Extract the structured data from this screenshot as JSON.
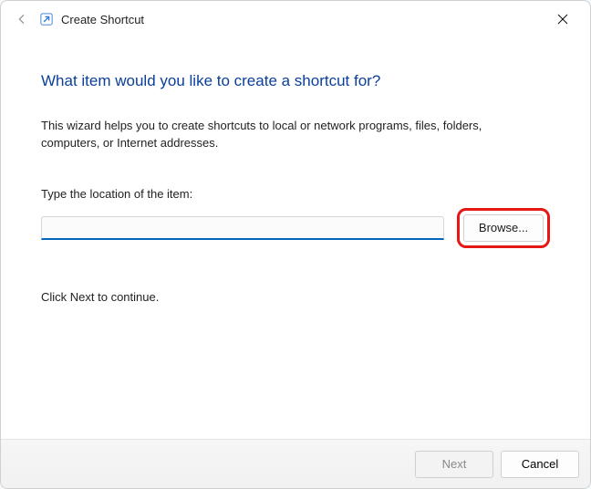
{
  "titlebar": {
    "title": "Create Shortcut"
  },
  "content": {
    "heading": "What item would you like to create a shortcut for?",
    "description": "This wizard helps you to create shortcuts to local or network programs, files, folders, computers, or Internet addresses.",
    "input_label": "Type the location of the item:",
    "input_value": "",
    "browse_label": "Browse...",
    "continue_hint": "Click Next to continue."
  },
  "footer": {
    "next_label": "Next",
    "next_enabled": false,
    "cancel_label": "Cancel"
  },
  "annotation": {
    "highlighted_control": "browse-button"
  }
}
